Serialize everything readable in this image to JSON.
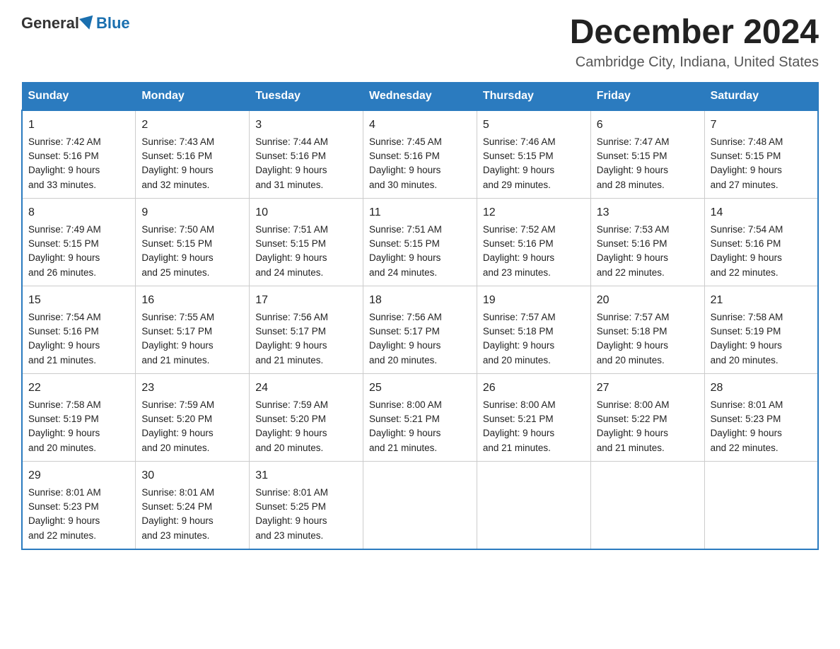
{
  "logo": {
    "general": "General",
    "blue": "Blue"
  },
  "title": "December 2024",
  "subtitle": "Cambridge City, Indiana, United States",
  "days_of_week": [
    "Sunday",
    "Monday",
    "Tuesday",
    "Wednesday",
    "Thursday",
    "Friday",
    "Saturday"
  ],
  "weeks": [
    [
      {
        "day": "1",
        "sunrise": "7:42 AM",
        "sunset": "5:16 PM",
        "daylight": "9 hours and 33 minutes."
      },
      {
        "day": "2",
        "sunrise": "7:43 AM",
        "sunset": "5:16 PM",
        "daylight": "9 hours and 32 minutes."
      },
      {
        "day": "3",
        "sunrise": "7:44 AM",
        "sunset": "5:16 PM",
        "daylight": "9 hours and 31 minutes."
      },
      {
        "day": "4",
        "sunrise": "7:45 AM",
        "sunset": "5:16 PM",
        "daylight": "9 hours and 30 minutes."
      },
      {
        "day": "5",
        "sunrise": "7:46 AM",
        "sunset": "5:15 PM",
        "daylight": "9 hours and 29 minutes."
      },
      {
        "day": "6",
        "sunrise": "7:47 AM",
        "sunset": "5:15 PM",
        "daylight": "9 hours and 28 minutes."
      },
      {
        "day": "7",
        "sunrise": "7:48 AM",
        "sunset": "5:15 PM",
        "daylight": "9 hours and 27 minutes."
      }
    ],
    [
      {
        "day": "8",
        "sunrise": "7:49 AM",
        "sunset": "5:15 PM",
        "daylight": "9 hours and 26 minutes."
      },
      {
        "day": "9",
        "sunrise": "7:50 AM",
        "sunset": "5:15 PM",
        "daylight": "9 hours and 25 minutes."
      },
      {
        "day": "10",
        "sunrise": "7:51 AM",
        "sunset": "5:15 PM",
        "daylight": "9 hours and 24 minutes."
      },
      {
        "day": "11",
        "sunrise": "7:51 AM",
        "sunset": "5:15 PM",
        "daylight": "9 hours and 24 minutes."
      },
      {
        "day": "12",
        "sunrise": "7:52 AM",
        "sunset": "5:16 PM",
        "daylight": "9 hours and 23 minutes."
      },
      {
        "day": "13",
        "sunrise": "7:53 AM",
        "sunset": "5:16 PM",
        "daylight": "9 hours and 22 minutes."
      },
      {
        "day": "14",
        "sunrise": "7:54 AM",
        "sunset": "5:16 PM",
        "daylight": "9 hours and 22 minutes."
      }
    ],
    [
      {
        "day": "15",
        "sunrise": "7:54 AM",
        "sunset": "5:16 PM",
        "daylight": "9 hours and 21 minutes."
      },
      {
        "day": "16",
        "sunrise": "7:55 AM",
        "sunset": "5:17 PM",
        "daylight": "9 hours and 21 minutes."
      },
      {
        "day": "17",
        "sunrise": "7:56 AM",
        "sunset": "5:17 PM",
        "daylight": "9 hours and 21 minutes."
      },
      {
        "day": "18",
        "sunrise": "7:56 AM",
        "sunset": "5:17 PM",
        "daylight": "9 hours and 20 minutes."
      },
      {
        "day": "19",
        "sunrise": "7:57 AM",
        "sunset": "5:18 PM",
        "daylight": "9 hours and 20 minutes."
      },
      {
        "day": "20",
        "sunrise": "7:57 AM",
        "sunset": "5:18 PM",
        "daylight": "9 hours and 20 minutes."
      },
      {
        "day": "21",
        "sunrise": "7:58 AM",
        "sunset": "5:19 PM",
        "daylight": "9 hours and 20 minutes."
      }
    ],
    [
      {
        "day": "22",
        "sunrise": "7:58 AM",
        "sunset": "5:19 PM",
        "daylight": "9 hours and 20 minutes."
      },
      {
        "day": "23",
        "sunrise": "7:59 AM",
        "sunset": "5:20 PM",
        "daylight": "9 hours and 20 minutes."
      },
      {
        "day": "24",
        "sunrise": "7:59 AM",
        "sunset": "5:20 PM",
        "daylight": "9 hours and 20 minutes."
      },
      {
        "day": "25",
        "sunrise": "8:00 AM",
        "sunset": "5:21 PM",
        "daylight": "9 hours and 21 minutes."
      },
      {
        "day": "26",
        "sunrise": "8:00 AM",
        "sunset": "5:21 PM",
        "daylight": "9 hours and 21 minutes."
      },
      {
        "day": "27",
        "sunrise": "8:00 AM",
        "sunset": "5:22 PM",
        "daylight": "9 hours and 21 minutes."
      },
      {
        "day": "28",
        "sunrise": "8:01 AM",
        "sunset": "5:23 PM",
        "daylight": "9 hours and 22 minutes."
      }
    ],
    [
      {
        "day": "29",
        "sunrise": "8:01 AM",
        "sunset": "5:23 PM",
        "daylight": "9 hours and 22 minutes."
      },
      {
        "day": "30",
        "sunrise": "8:01 AM",
        "sunset": "5:24 PM",
        "daylight": "9 hours and 23 minutes."
      },
      {
        "day": "31",
        "sunrise": "8:01 AM",
        "sunset": "5:25 PM",
        "daylight": "9 hours and 23 minutes."
      },
      null,
      null,
      null,
      null
    ]
  ],
  "labels": {
    "sunrise_prefix": "Sunrise: ",
    "sunset_prefix": "Sunset: ",
    "daylight_prefix": "Daylight: 9 hours"
  }
}
